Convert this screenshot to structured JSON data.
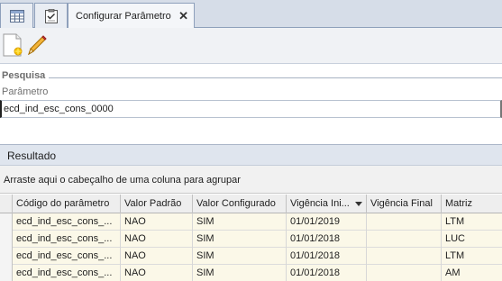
{
  "tabs": {
    "active_label": "Configurar Parâmetro",
    "close_glyph": "✕"
  },
  "toolbar": {
    "new_icon": "new-document-icon",
    "edit_icon": "pencil-icon"
  },
  "search": {
    "group_title": "Pesquisa",
    "parametro_label": "Parâmetro",
    "parametro_value": "ecd_ind_esc_cons_0000"
  },
  "result": {
    "title": "Resultado",
    "group_hint": "Arraste aqui o cabeçalho de uma coluna para agrupar"
  },
  "grid": {
    "columns": [
      "Código do parâmetro",
      "Valor Padrão",
      "Valor Configurado",
      "Vigência Ini...",
      "Vigência Final",
      "Matriz"
    ],
    "sort_column": "Vigência Ini...",
    "rows": [
      [
        "ecd_ind_esc_cons_...",
        "NAO",
        "SIM",
        "01/01/2019",
        "",
        "LTM"
      ],
      [
        "ecd_ind_esc_cons_...",
        "NAO",
        "SIM",
        "01/01/2018",
        "",
        "LUC"
      ],
      [
        "ecd_ind_esc_cons_...",
        "NAO",
        "SIM",
        "01/01/2018",
        "",
        "LTM"
      ],
      [
        "ecd_ind_esc_cons_...",
        "NAO",
        "SIM",
        "01/01/2018",
        "",
        "AM"
      ]
    ]
  },
  "colors": {
    "row_background": "#fbf8e8",
    "tabstrip": "#d6dde8",
    "header_background": "#eeeeee"
  }
}
